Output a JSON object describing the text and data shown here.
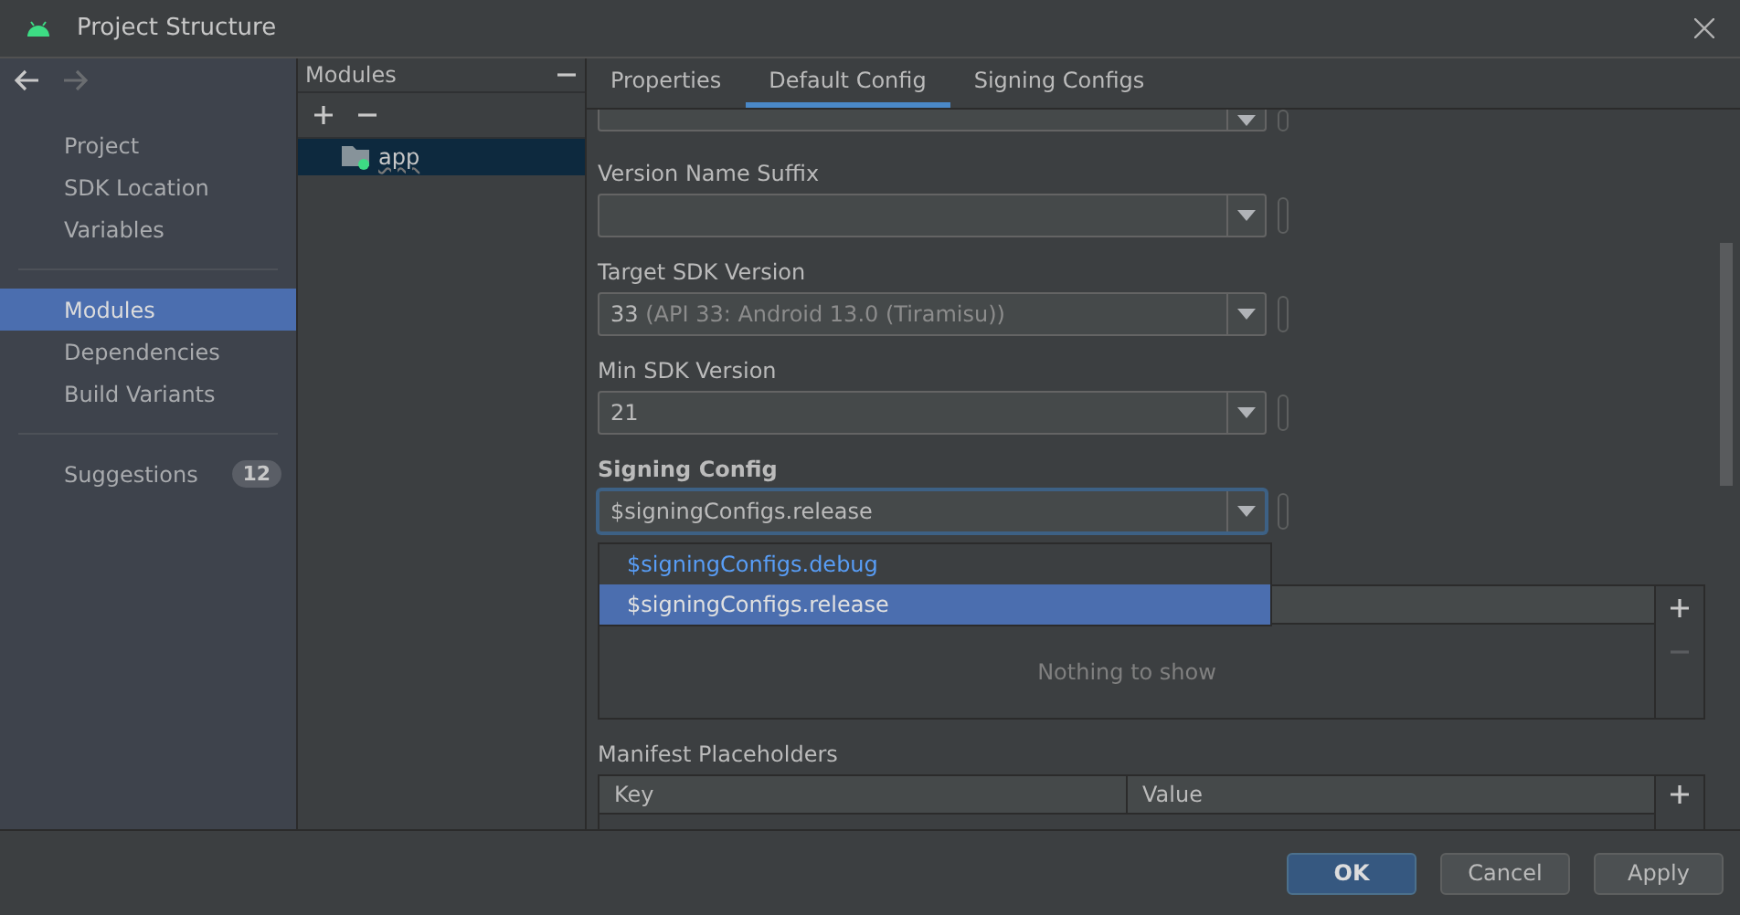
{
  "window": {
    "title": "Project Structure"
  },
  "nav": {
    "groups": [
      [
        {
          "label": "Project",
          "selected": false
        },
        {
          "label": "SDK Location",
          "selected": false
        },
        {
          "label": "Variables",
          "selected": false
        }
      ],
      [
        {
          "label": "Modules",
          "selected": true
        },
        {
          "label": "Dependencies",
          "selected": false
        },
        {
          "label": "Build Variants",
          "selected": false
        }
      ],
      [
        {
          "label": "Suggestions",
          "selected": false,
          "badge": "12"
        }
      ]
    ]
  },
  "modules_panel": {
    "title": "Modules",
    "items": [
      {
        "label": "app",
        "selected": true
      }
    ]
  },
  "tabs": [
    {
      "label": "Properties",
      "selected": false
    },
    {
      "label": "Default Config",
      "selected": true
    },
    {
      "label": "Signing Configs",
      "selected": false
    }
  ],
  "fields": [
    {
      "label": "Version Name Suffix",
      "focused": false
    },
    {
      "label": "Target SDK Version",
      "value": "33",
      "hint": "(API 33: Android 13.0 (Tiramisu))",
      "focused": false
    },
    {
      "label": "Min SDK Version",
      "value": "21",
      "focused": false
    },
    {
      "label": "Signing Config",
      "value": "$signingConfigs.release",
      "focused": true
    }
  ],
  "dropdown": {
    "options": [
      {
        "label": "$signingConfigs.debug",
        "selected": false
      },
      {
        "label": "$signingConfigs.release",
        "selected": true
      }
    ]
  },
  "empty_table": {
    "empty_text": "Nothing to show"
  },
  "manifest": {
    "label": "Manifest Placeholders",
    "columns": [
      "Key",
      "Value"
    ]
  },
  "buttons": [
    {
      "label": "OK",
      "primary": true
    },
    {
      "label": "Cancel",
      "primary": false
    },
    {
      "label": "Apply",
      "primary": false
    }
  ]
}
